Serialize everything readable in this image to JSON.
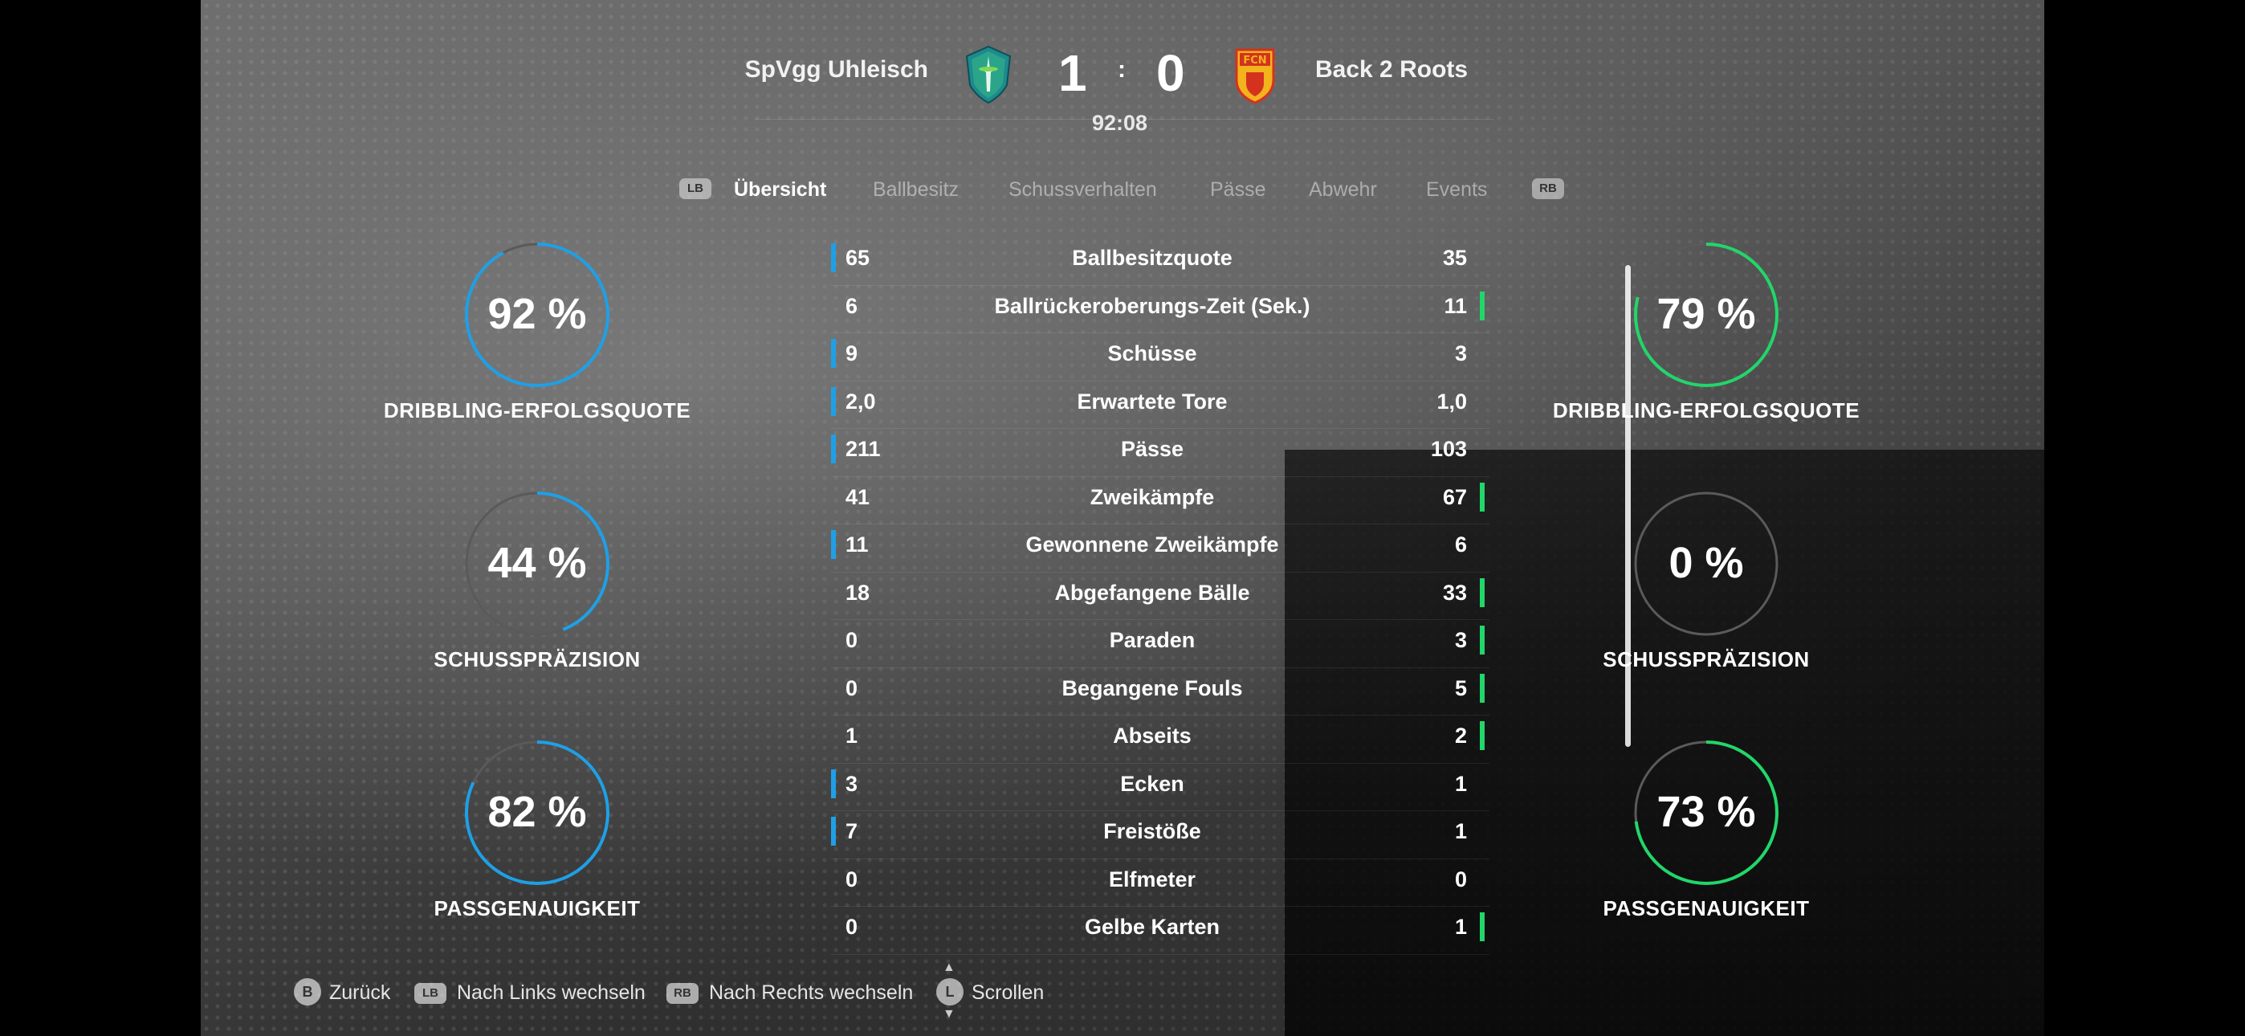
{
  "match": {
    "home_team": "SpVgg Uhleisch",
    "away_team": "Back 2 Roots",
    "home_score": "1",
    "score_separator": ":",
    "away_score": "0",
    "clock": "92:08",
    "away_crest_text": "FCN"
  },
  "tabs": {
    "left_button": "LB",
    "right_button": "RB",
    "items": [
      {
        "label": "Übersicht",
        "active": true
      },
      {
        "label": "Ballbesitz",
        "active": false
      },
      {
        "label": "Schussverhalten",
        "active": false
      },
      {
        "label": "Pässe",
        "active": false
      },
      {
        "label": "Abwehr",
        "active": false
      },
      {
        "label": "Events",
        "active": false
      }
    ]
  },
  "home_rings": [
    {
      "value": "92 %",
      "label": "DRIBBLING-ERFOLGSQUOTE",
      "percent": 92
    },
    {
      "value": "44 %",
      "label": "SCHUSSPRÄZISION",
      "percent": 44
    },
    {
      "value": "82 %",
      "label": "PASSGENAUIGKEIT",
      "percent": 82
    }
  ],
  "away_rings": [
    {
      "value": "79 %",
      "label": "DRIBBLING-ERFOLGSQUOTE",
      "percent": 79
    },
    {
      "value": "0 %",
      "label": "SCHUSSPRÄZISION",
      "percent": 0
    },
    {
      "value": "73 %",
      "label": "PASSGENAUIGKEIT",
      "percent": 73
    }
  ],
  "stats": [
    {
      "label": "Ballbesitzquote",
      "home": "65",
      "away": "35",
      "lead": "home"
    },
    {
      "label": "Ballrückeroberungs-Zeit (Sek.)",
      "home": "6",
      "away": "11",
      "lead": "away"
    },
    {
      "label": "Schüsse",
      "home": "9",
      "away": "3",
      "lead": "home"
    },
    {
      "label": "Erwartete Tore",
      "home": "2,0",
      "away": "1,0",
      "lead": "home"
    },
    {
      "label": "Pässe",
      "home": "211",
      "away": "103",
      "lead": "home"
    },
    {
      "label": "Zweikämpfe",
      "home": "41",
      "away": "67",
      "lead": "away"
    },
    {
      "label": "Gewonnene Zweikämpfe",
      "home": "11",
      "away": "6",
      "lead": "home"
    },
    {
      "label": "Abgefangene Bälle",
      "home": "18",
      "away": "33",
      "lead": "away"
    },
    {
      "label": "Paraden",
      "home": "0",
      "away": "3",
      "lead": "away"
    },
    {
      "label": "Begangene Fouls",
      "home": "0",
      "away": "5",
      "lead": "away"
    },
    {
      "label": "Abseits",
      "home": "1",
      "away": "2",
      "lead": "away"
    },
    {
      "label": "Ecken",
      "home": "3",
      "away": "1",
      "lead": "home"
    },
    {
      "label": "Freistöße",
      "home": "7",
      "away": "1",
      "lead": "home"
    },
    {
      "label": "Elfmeter",
      "home": "0",
      "away": "0",
      "lead": "none"
    },
    {
      "label": "Gelbe Karten",
      "home": "0",
      "away": "1",
      "lead": "away"
    }
  ],
  "footer": {
    "back_button": "B",
    "back_label": "Zurück",
    "lb_button": "LB",
    "lb_label": "Nach Links wechseln",
    "rb_button": "RB",
    "rb_label": "Nach Rechts wechseln",
    "scroll_button": "L",
    "scroll_label": "Scrollen"
  },
  "colors": {
    "home_accent": "#1ea0e6",
    "away_accent": "#22d66a",
    "ring_track": "#5a5a5a"
  },
  "icons": {
    "home_crest": "space-needle-crest-icon",
    "away_crest": "fcn-crest-icon"
  }
}
